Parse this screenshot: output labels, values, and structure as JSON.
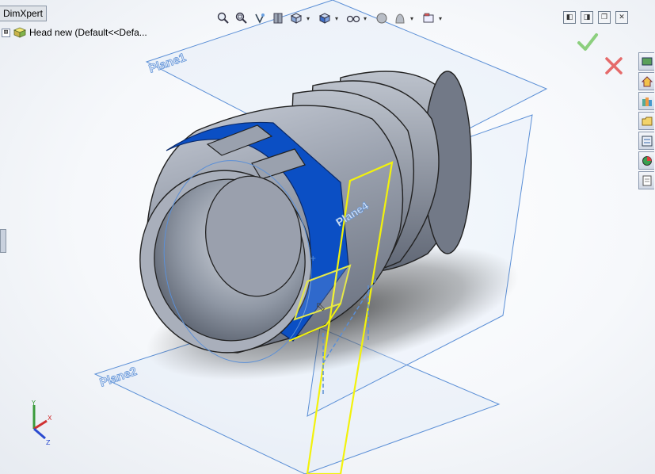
{
  "tab": {
    "label": "DimXpert"
  },
  "tree": {
    "expander": "⊞",
    "part_label": "Head new  (Default<<Defa..."
  },
  "planes": {
    "plane1": "Plane1",
    "plane2": "Plane2",
    "plane4": "Plane4"
  },
  "hud_icons": [
    "zoom-to-fit-icon",
    "zoom-area-icon",
    "previous-view-icon",
    "section-view-icon",
    "view-orientation-icon",
    "display-style-icon",
    "hide-show-items-icon",
    "edit-appearance-icon",
    "apply-scene-icon",
    "view-settings-icon"
  ],
  "window_buttons": {
    "tile_left": "◧",
    "tile_right": "◨",
    "restore": "❐",
    "close": "✕"
  },
  "colors": {
    "accent_face": "#0b4fc4",
    "sketch_yellow": "#f2f20c",
    "plane_blue": "#5b8fd6",
    "ok_green": "#8ccf7e",
    "cancel_red": "#e56a6a"
  }
}
